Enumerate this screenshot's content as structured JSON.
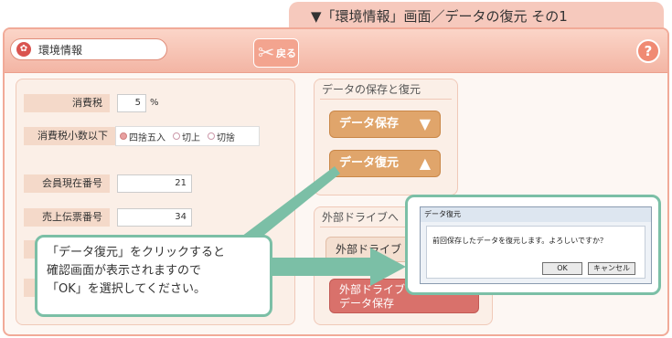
{
  "caption": "▼「環境情報」画面／データの復元 その1",
  "app": {
    "title": "環境情報",
    "back_label": "戻る",
    "help_label": "?"
  },
  "settings": {
    "tax": {
      "label": "消費税",
      "value": "5",
      "unit": "%"
    },
    "tax_decimal": {
      "label": "消費税小数以下",
      "options": [
        "四捨五入",
        "切上",
        "切捨"
      ],
      "selected": "四捨五入"
    },
    "member_no": {
      "label": "会員現在番号",
      "value": "21"
    },
    "slip_no": {
      "label": "売上伝票番号",
      "value": "34"
    }
  },
  "backup": {
    "heading": "データの保存と復元",
    "save_label": "データ保存",
    "restore_label": "データ復元"
  },
  "external": {
    "heading": "外部ドライブへ",
    "drive_label": "外部ドライブ",
    "save_line1": "外部ドライブ",
    "save_line2": "データ保存"
  },
  "callout": {
    "line1": "「データ復元」をクリックすると",
    "line2": "確認画面が表示されますので",
    "line3": "「OK」を選択してください。"
  },
  "dialog": {
    "title": "データ復元",
    "message": "前回保存したデータを復元します。よろしいですか？",
    "ok_label": "OK",
    "cancel_label": "キャンセル"
  },
  "colors": {
    "frame": "#f1aa98",
    "callout_border": "#7bbfa6",
    "tan_button": "#e0a56b",
    "red_button": "#d9716b"
  }
}
